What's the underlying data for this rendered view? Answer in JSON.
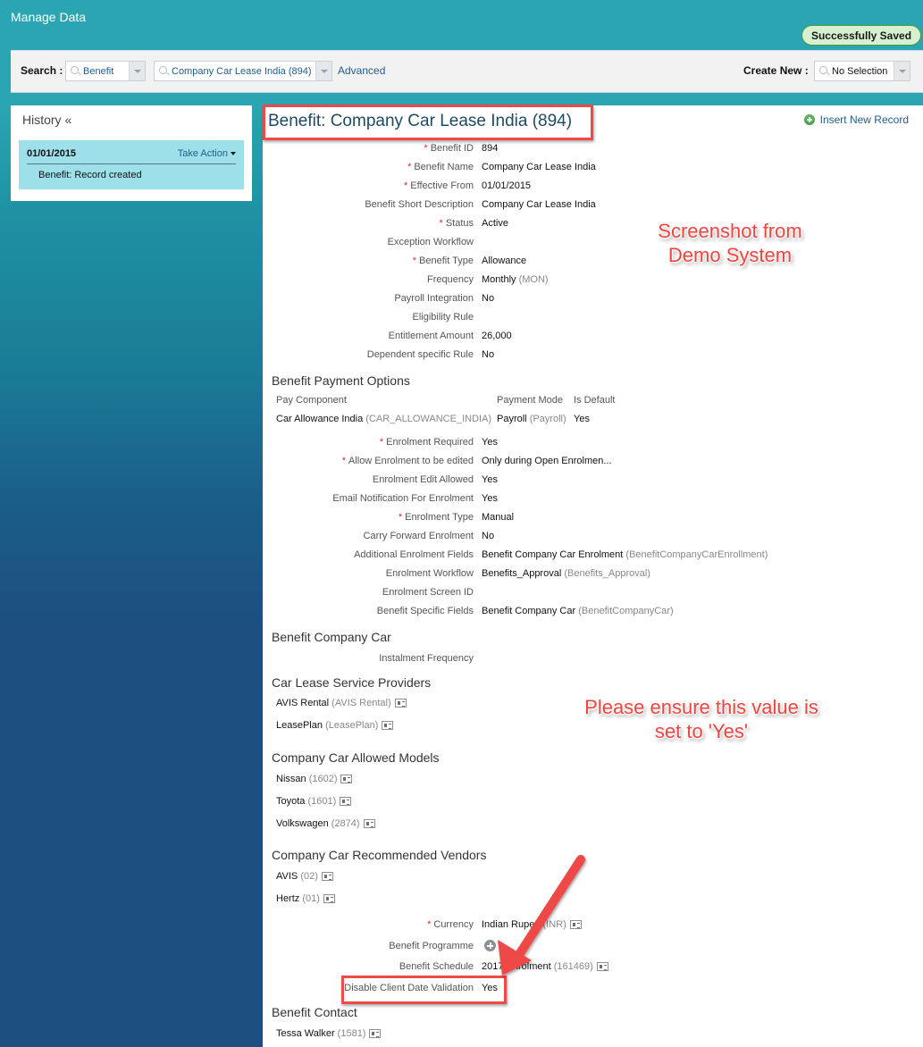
{
  "app": {
    "title": "Manage Data"
  },
  "status": {
    "message": "Successfully Saved"
  },
  "search": {
    "label": "Search :",
    "object_type": "Benefit",
    "record": "Company Car Lease India (894)",
    "advanced_label": "Advanced",
    "create_new_label": "Create New :",
    "create_new_value": "No Selection"
  },
  "history": {
    "title": "History «",
    "entries": [
      {
        "date": "01/01/2015",
        "action_label": "Take Action",
        "description": "Benefit: Record created"
      }
    ]
  },
  "record": {
    "title": "Benefit: Company Car Lease India (894)",
    "insert_label": "Insert New Record",
    "fields": [
      {
        "label": "Benefit ID",
        "required": true,
        "value": "894",
        "code": ""
      },
      {
        "label": "Benefit Name",
        "required": true,
        "value": "Company Car Lease India",
        "code": ""
      },
      {
        "label": "Effective From",
        "required": true,
        "value": "01/01/2015",
        "code": ""
      },
      {
        "label": "Benefit Short Description",
        "required": false,
        "value": "Company Car Lease India",
        "code": ""
      },
      {
        "label": "Status",
        "required": true,
        "value": "Active",
        "code": ""
      },
      {
        "label": "Exception Workflow",
        "required": false,
        "value": "",
        "code": ""
      },
      {
        "label": "Benefit Type",
        "required": true,
        "value": "Allowance",
        "code": ""
      },
      {
        "label": "Frequency",
        "required": false,
        "value": "Monthly",
        "code": "(MON)"
      },
      {
        "label": "Payroll Integration",
        "required": false,
        "value": "No",
        "code": ""
      },
      {
        "label": "Eligibility Rule",
        "required": false,
        "value": "",
        "code": ""
      },
      {
        "label": "Entitlement Amount",
        "required": false,
        "value": "26,000",
        "code": ""
      },
      {
        "label": "Dependent specific Rule",
        "required": false,
        "value": "No",
        "code": ""
      }
    ],
    "payment_options": {
      "title": "Benefit Payment Options",
      "headers": [
        "Pay Component",
        "Payment Mode",
        "Is Default"
      ],
      "rows": [
        {
          "component": "Car Allowance India",
          "component_code": "(CAR_ALLOWANCE_INDIA)",
          "mode": "Payroll",
          "mode_code": "(Payroll)",
          "is_default": "Yes"
        }
      ]
    },
    "enrolment_fields": [
      {
        "label": "Enrolment Required",
        "required": true,
        "value": "Yes",
        "code": ""
      },
      {
        "label": "Allow Enrolment to be edited",
        "required": true,
        "value": "Only during Open Enrolmen...",
        "code": ""
      },
      {
        "label": "Enrolment Edit Allowed",
        "required": false,
        "value": "Yes",
        "code": ""
      },
      {
        "label": "Email Notification For Enrolment",
        "required": false,
        "value": "Yes",
        "code": ""
      },
      {
        "label": "Enrolment Type",
        "required": true,
        "value": "Manual",
        "code": ""
      },
      {
        "label": "Carry Forward Enrolment",
        "required": false,
        "value": "No",
        "code": ""
      },
      {
        "label": "Additional Enrolment Fields",
        "required": false,
        "value": "Benefit Company Car Enrolment",
        "code": "(BenefitCompanyCarEnrollment)"
      },
      {
        "label": "Enrolment Workflow",
        "required": false,
        "value": "Benefits_Approval",
        "code": "(Benefits_Approval)"
      },
      {
        "label": "Enrolment Screen ID",
        "required": false,
        "value": "",
        "code": ""
      },
      {
        "label": "Benefit Specific Fields",
        "required": false,
        "value": "Benefit Company Car",
        "code": "(BenefitCompanyCar)"
      }
    ],
    "company_car": {
      "title": "Benefit Company Car",
      "instalment_label": "Instalment Frequency"
    },
    "lease_providers": {
      "title": "Car Lease Service Providers",
      "items": [
        {
          "name": "AVIS Rental",
          "code": "(AVIS Rental)"
        },
        {
          "name": "LeasePlan",
          "code": "(LeasePlan)"
        }
      ]
    },
    "allowed_models": {
      "title": "Company Car Allowed Models",
      "items": [
        {
          "name": "Nissan",
          "code": "(1602)"
        },
        {
          "name": "Toyota",
          "code": "(1601)"
        },
        {
          "name": "Volkswagen",
          "code": "(2874)"
        }
      ]
    },
    "vendors": {
      "title": "Company Car Recommended Vendors",
      "items": [
        {
          "name": "AVIS",
          "code": "(02)"
        },
        {
          "name": "Hertz",
          "code": "(01)"
        }
      ]
    },
    "bottom_fields": {
      "currency_label": "Currency",
      "currency_value": "Indian Rupee",
      "currency_code": "(INR)",
      "programme_label": "Benefit Programme",
      "schedule_label": "Benefit Schedule",
      "schedule_value": "2017 Enrolment",
      "schedule_code": "(161469)",
      "validation_label": "Disable Client Date Validation",
      "validation_value": "Yes"
    },
    "contact": {
      "title": "Benefit Contact",
      "items": [
        {
          "name": "Tessa Walker",
          "code": "(1581)"
        }
      ]
    }
  },
  "annotations": {
    "demo_note_line1": "Screenshot from",
    "demo_note_line2": "Demo System",
    "ensure_note_line1": "Please ensure this value is",
    "ensure_note_line2": "set to 'Yes'"
  },
  "colors": {
    "header_teal": "#2aa5b1",
    "link_blue": "#1f5d91",
    "annotation_red": "#ee4a47",
    "success_green": "#d7f0d0"
  }
}
